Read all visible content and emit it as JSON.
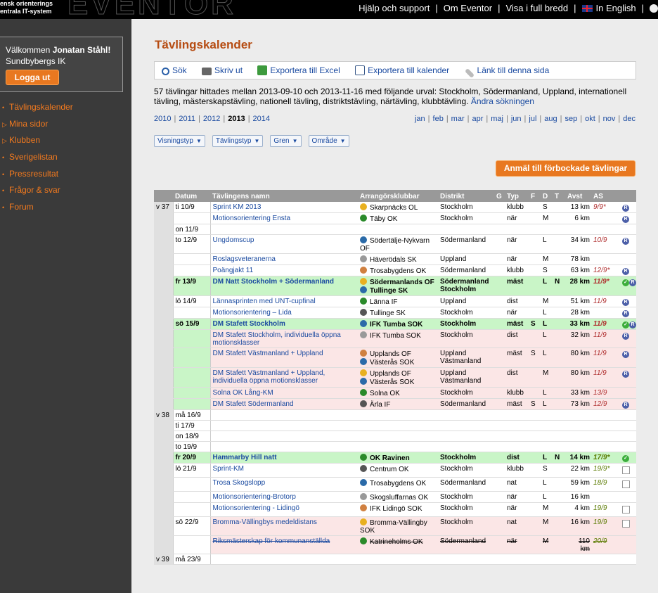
{
  "topbar": {
    "org_lines": [
      "ensk orienterings",
      "entrala IT-system"
    ],
    "logo_text": "EVENTOR",
    "links": [
      "Hjälp och support",
      "Om Eventor",
      "Visa i full bredd",
      "In English"
    ],
    "separator": "|"
  },
  "sidebar": {
    "welcome_prefix": "Välkommen ",
    "user_name": "Jonatan Ståhl!",
    "club": "Sundbybergs IK",
    "logout_label": "Logga ut",
    "menu": [
      {
        "label": "Tävlingskalender",
        "bullet": "•"
      },
      {
        "label": "Mina sidor",
        "bullet": "▷"
      },
      {
        "label": "Klubben",
        "bullet": "▷"
      },
      {
        "label": "Sverigelistan",
        "bullet": "•"
      },
      {
        "label": "Pressresultat",
        "bullet": "•"
      },
      {
        "label": "Frågor & svar",
        "bullet": "•"
      },
      {
        "label": "Forum",
        "bullet": "•"
      }
    ]
  },
  "main": {
    "title": "Tävlingskalender",
    "toolbar": [
      "Sök",
      "Skriv ut",
      "Exportera till Excel",
      "Exportera till kalender",
      "Länk till denna sida"
    ],
    "summary": "57 tävlingar hittades mellan 2013-09-10 och 2013-11-16 med följande urval: Stockholm, Södermanland, Uppland, internationell tävling, mästerskapstävling, nationell tävling, distriktstävling, närtävling, klubbtävling.",
    "summary_link": "Ändra sökningen",
    "years": [
      "2010",
      "2011",
      "2012",
      "2013",
      "2014"
    ],
    "current_year": "2013",
    "months": [
      "jan",
      "feb",
      "mar",
      "apr",
      "maj",
      "jun",
      "jul",
      "aug",
      "sep",
      "okt",
      "nov",
      "dec"
    ],
    "filters": [
      "Visningstyp",
      "Tävlingstyp",
      "Gren",
      "Område"
    ],
    "register_button": "Anmäl till förbockade tävlingar",
    "columns": [
      "Datum",
      "Tävlingens namn",
      "Arrangörsklubbar",
      "Distrikt",
      "G",
      "Typ",
      "F",
      "D",
      "T",
      "Avst",
      "AS"
    ]
  },
  "colors": {
    "accent": "#e87820",
    "title": "#b64c12",
    "link": "#1a4aa0",
    "green_row": "#c9f5c7",
    "pink_row": "#fbe6e6",
    "sidebar": "#3a3a3a"
  },
  "rows": [
    {
      "week": "v 37",
      "date": "ti 10/9",
      "name": "Sprint KM 2013",
      "org": "Skarpnäcks OL",
      "district": "Stockholm",
      "g": "",
      "typ": "klubb",
      "f": "",
      "d": "S",
      "t": "",
      "km": "13 km",
      "as": "9/9*",
      "icon": "R",
      "bg": "",
      "bold": false
    },
    {
      "week": "",
      "date": "",
      "name": "Motionsorientering Ensta",
      "org": "Täby OK",
      "district": "Stockholm",
      "g": "",
      "typ": "när",
      "f": "",
      "d": "M",
      "t": "",
      "km": "6 km",
      "as": "",
      "icon": "R",
      "bg": "",
      "bold": false
    },
    {
      "week": "",
      "date": "on 11/9",
      "empty": true
    },
    {
      "week": "",
      "date": "to 12/9",
      "name": "Ungdomscup",
      "org": "Södertälje-Nykvarn OF",
      "district": "Södermanland",
      "g": "",
      "typ": "när",
      "f": "",
      "d": "L",
      "t": "",
      "km": "34 km",
      "as": "10/9",
      "icon": "R",
      "bg": "",
      "bold": false
    },
    {
      "week": "",
      "date": "",
      "name": "Roslagsveteranerna",
      "org": "Häverödals SK",
      "district": "Uppland",
      "g": "",
      "typ": "när",
      "f": "",
      "d": "M",
      "t": "",
      "km": "78 km",
      "as": "",
      "icon": "",
      "bg": "",
      "bold": false
    },
    {
      "week": "",
      "date": "",
      "name": "Poängjakt 11",
      "org": "Trosabygdens OK",
      "district": "Södermanland",
      "g": "",
      "typ": "klubb",
      "f": "",
      "d": "S",
      "t": "",
      "km": "63 km",
      "as": "12/9*",
      "icon": "R",
      "bg": "",
      "bold": false
    },
    {
      "week": "",
      "date": "fr 13/9",
      "name": "DM Natt Stockholm + Södermanland",
      "org": "Södermanlands OF",
      "org2": "Tullinge SK",
      "district": "Södermanland",
      "district2": "Stockholm",
      "g": "",
      "typ": "mäst",
      "f": "",
      "d": "L",
      "t": "N",
      "km": "28 km",
      "as": "11/9*",
      "icon": "GR",
      "bg": "g",
      "bold": true
    },
    {
      "week": "",
      "date": "lö 14/9",
      "name": "Lännasprinten med UNT-cupfinal",
      "org": "Länna IF",
      "district": "Uppland",
      "g": "",
      "typ": "dist",
      "f": "",
      "d": "M",
      "t": "",
      "km": "51 km",
      "as": "11/9",
      "icon": "R",
      "bg": "",
      "bold": false
    },
    {
      "week": "",
      "date": "",
      "name": "Motionsorientering – Lida",
      "org": "Tullinge SK",
      "district": "Stockholm",
      "g": "",
      "typ": "när",
      "f": "",
      "d": "L",
      "t": "",
      "km": "28 km",
      "as": "",
      "icon": "R",
      "bg": "",
      "bold": false
    },
    {
      "week": "",
      "date": "sö 15/9",
      "name": "DM Stafett Stockholm",
      "org": "IFK Tumba SOK",
      "district": "Stockholm",
      "g": "",
      "typ": "mäst",
      "f": "S",
      "d": "L",
      "t": "",
      "km": "33 km",
      "as": "11/9",
      "icon": "GR",
      "bg": "g",
      "bold": true
    },
    {
      "week": "",
      "date": "",
      "name": "DM Stafett Stockholm, individuella öppna motionsklasser",
      "org": "IFK Tumba SOK",
      "district": "Stockholm",
      "g": "",
      "typ": "dist",
      "f": "",
      "d": "L",
      "t": "",
      "km": "32 km",
      "as": "11/9",
      "icon": "R",
      "bg": "p",
      "bold": false
    },
    {
      "week": "",
      "date": "",
      "name": "DM Stafett Västmanland + Uppland",
      "org": "Upplands OF",
      "org2": "Västerås SOK",
      "district": "Uppland",
      "district2": "Västmanland",
      "g": "",
      "typ": "mäst",
      "f": "S",
      "d": "L",
      "t": "",
      "km": "80 km",
      "as": "11/9",
      "icon": "R",
      "bg": "p",
      "bold": false
    },
    {
      "week": "",
      "date": "",
      "name": "DM Stafett Västmanland + Uppland, individuella öppna motionsklasser",
      "org": "Upplands OF",
      "org2": "Västerås SOK",
      "district": "Uppland",
      "district2": "Västmanland",
      "g": "",
      "typ": "dist",
      "f": "",
      "d": "M",
      "t": "",
      "km": "80 km",
      "as": "11/9",
      "icon": "R",
      "bg": "p",
      "bold": false
    },
    {
      "week": "",
      "date": "",
      "name": "Solna OK Lång-KM",
      "org": "Solna OK",
      "district": "Stockholm",
      "g": "",
      "typ": "klubb",
      "f": "",
      "d": "L",
      "t": "",
      "km": "33 km",
      "as": "13/9",
      "icon": "",
      "bg": "p",
      "bold": false
    },
    {
      "week": "",
      "date": "",
      "name": "DM Stafett Södermanland",
      "org": "Ärla IF",
      "district": "Södermanland",
      "g": "",
      "typ": "mäst",
      "f": "S",
      "d": "L",
      "t": "",
      "km": "73 km",
      "as": "12/9",
      "icon": "R",
      "bg": "p",
      "bold": false
    },
    {
      "week": "v 38",
      "date": "må 16/9",
      "empty": true
    },
    {
      "week": "",
      "date": "ti 17/9",
      "empty": true
    },
    {
      "week": "",
      "date": "on 18/9",
      "empty": true
    },
    {
      "week": "",
      "date": "to 19/9",
      "empty": true
    },
    {
      "week": "",
      "date": "fr 20/9",
      "name": "Hammarby Hill natt",
      "org": "OK Ravinen",
      "district": "Stockholm",
      "g": "",
      "typ": "dist",
      "f": "",
      "d": "L",
      "t": "N",
      "km": "14 km",
      "as": "17/9*",
      "asok": true,
      "icon": "G",
      "bg": "g",
      "bold": true
    },
    {
      "week": "",
      "date": "lö 21/9",
      "name": "Sprint-KM",
      "org": "Centrum OK",
      "district": "Stockholm",
      "g": "",
      "typ": "klubb",
      "f": "",
      "d": "S",
      "t": "",
      "km": "22 km",
      "as": "19/9*",
      "asok": true,
      "icon": "C",
      "bg": "",
      "bold": false
    },
    {
      "week": "",
      "date": "",
      "name": "Trosa Skogslopp",
      "org": "Trosabygdens OK",
      "district": "Södermanland",
      "g": "",
      "typ": "nat",
      "f": "",
      "d": "L",
      "t": "",
      "km": "59 km",
      "as": "18/9",
      "asok": true,
      "icon": "C",
      "bg": "",
      "bold": false
    },
    {
      "week": "",
      "date": "",
      "name": "Motionsorientering-Brotorp",
      "org": "Skogsluffarnas OK",
      "district": "Stockholm",
      "g": "",
      "typ": "när",
      "f": "",
      "d": "L",
      "t": "",
      "km": "16 km",
      "as": "",
      "icon": "",
      "bg": "",
      "bold": false
    },
    {
      "week": "",
      "date": "",
      "name": "Motionsorientering - Lidingö",
      "org": "IFK Lidingö SOK",
      "district": "Stockholm",
      "g": "",
      "typ": "när",
      "f": "",
      "d": "M",
      "t": "",
      "km": "4 km",
      "as": "19/9",
      "asok": true,
      "icon": "C",
      "bg": "",
      "bold": false
    },
    {
      "week": "",
      "date": "sö 22/9",
      "name": "Bromma-Vällingbys medeldistans",
      "org": "Bromma-Vällingby SOK",
      "district": "Stockholm",
      "g": "",
      "typ": "nat",
      "f": "",
      "d": "M",
      "t": "",
      "km": "16 km",
      "as": "19/9",
      "asok": true,
      "icon": "C",
      "bg": "p",
      "bold": false
    },
    {
      "week": "",
      "date": "",
      "name": "Riksmästerskap för kommunanställda",
      "org": "Katrineholms OK",
      "district": "Södermanland",
      "g": "",
      "typ": "när",
      "f": "",
      "d": "M",
      "t": "",
      "km": "110 km",
      "as": "20/9",
      "asok": true,
      "icon": "",
      "bg": "p",
      "bold": false,
      "strike": true
    },
    {
      "week": "v 39",
      "date": "må 23/9",
      "empty": true
    }
  ]
}
